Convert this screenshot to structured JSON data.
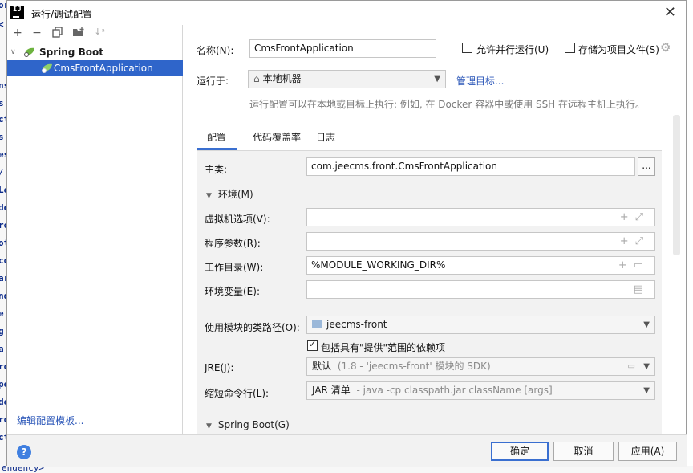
{
  "background_fragments": [
    "or",
    "<",
    "ns",
    "s",
    "ct",
    "s",
    "es",
    "/",
    "Le",
    "de",
    "ro",
    "ot",
    "co",
    "ar",
    "nd",
    "e",
    "g",
    "a",
    "ro",
    "pe",
    "de",
    "ro",
    "ct"
  ],
  "background_bottom": "endency>",
  "window": {
    "title": "运行/调试配置",
    "close_icon": "close-icon"
  },
  "left_pane": {
    "toolbar": [
      "add-icon",
      "remove-icon",
      "copy-icon",
      "folder-add-icon",
      "sort-icon"
    ],
    "tree": [
      {
        "label": "Spring Boot",
        "expanded": true,
        "selected": false
      },
      {
        "label": "CmsFrontApplication",
        "selected": true
      }
    ],
    "edit_templates_link": "编辑配置模板..."
  },
  "header": {
    "name_label": "名称(N):",
    "name_value": "CmsFrontApplication",
    "allow_parallel": {
      "label": "允许并行运行(U)",
      "checked": false
    },
    "store_as_project": {
      "label": "存储为项目文件(S)",
      "checked": false
    },
    "run_on_label": "运行于:",
    "run_on_value": "本地机器",
    "manage_targets": "管理目标...",
    "run_on_hint": "运行配置可以在本地或目标上执行: 例如, 在 Docker 容器中或使用 SSH 在远程主机上执行。"
  },
  "tabs": [
    {
      "label": "配置",
      "active": true
    },
    {
      "label": "代码覆盖率",
      "active": false
    },
    {
      "label": "日志",
      "active": false
    }
  ],
  "config": {
    "main_class_label": "主类:",
    "main_class_value": "com.jeecms.front.CmsFrontApplication",
    "browse_label": "...",
    "env_section": "环境(M)",
    "vm_options_label": "虚拟机选项(V):",
    "vm_options_value": "",
    "program_args_label": "程序参数(R):",
    "program_args_value": "",
    "working_dir_label": "工作目录(W):",
    "working_dir_value": "%MODULE_WORKING_DIR%",
    "env_vars_label": "环境变量(E):",
    "env_vars_value": "",
    "module_classpath_label": "使用模块的类路径(O):",
    "module_classpath_value": "jeecms-front",
    "include_provided": {
      "label": "包括具有\"提供\"范围的依赖项",
      "checked": true
    },
    "jre_label": "JRE(J):",
    "jre_value": "默认",
    "jre_hint": "(1.8 - 'jeecms-front' 模块的 SDK)",
    "shorten_label": "缩短命令行(L):",
    "shorten_value": "JAR 清单",
    "shorten_hint": "- java -cp classpath.jar className [args]",
    "springboot_section": "Spring Boot(G)"
  },
  "buttons": {
    "help": "?",
    "ok": "确定",
    "cancel": "取消",
    "apply": "应用(A)"
  },
  "colors": {
    "selection": "#2f65ca",
    "link": "#2a56b8",
    "accent": "#3a6fd0",
    "springboot_green": "#6db33f"
  }
}
